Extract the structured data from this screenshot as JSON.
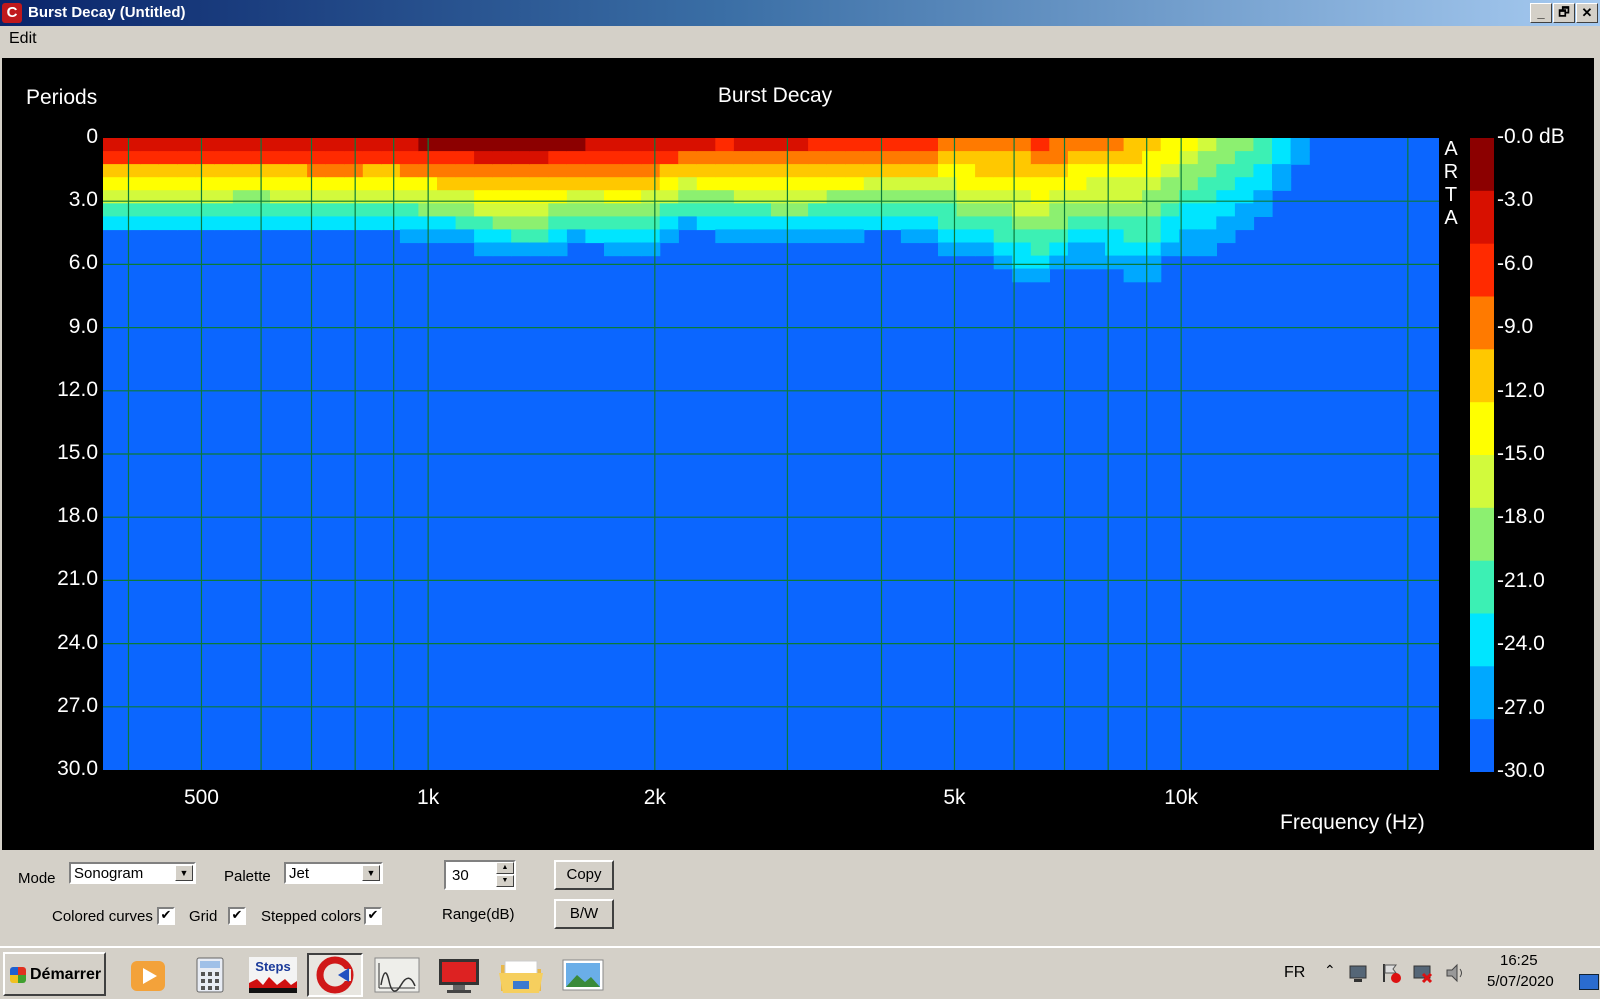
{
  "window": {
    "title": "Burst Decay  (Untitled)",
    "app_icon_letter": "C",
    "buttons": [
      "_",
      "🗗",
      "✕"
    ]
  },
  "menu": {
    "edit": "Edit"
  },
  "chart_data": {
    "type": "heatmap",
    "title": "Burst Decay",
    "xlabel": "Frequency (Hz)",
    "ylabel": "Periods",
    "x_scale": "log",
    "xlim": [
      370,
      22000
    ],
    "ylim": [
      0,
      30
    ],
    "x_ticks": [
      "500",
      "1k",
      "2k",
      "5k",
      "10k"
    ],
    "y_ticks": [
      "0",
      "3.0",
      "6.0",
      "9.0",
      "12.0",
      "15.0",
      "18.0",
      "21.0",
      "24.0",
      "27.0",
      "30.0"
    ],
    "colorbar_ticks": [
      "-0.0 dB",
      "-3.0",
      "-6.0",
      "-9.0",
      "-12.0",
      "-15.0",
      "-18.0",
      "-21.0",
      "-24.0",
      "-27.0",
      "-30.0"
    ],
    "colorbar_range_db": [
      -30,
      0
    ],
    "palette": [
      "#0b66ff",
      "#00a8ff",
      "#00e5ff",
      "#3cf0b4",
      "#8cf070",
      "#d2fa3c",
      "#ffff00",
      "#ffc800",
      "#ff7a00",
      "#ff2a00",
      "#d81000",
      "#8c0000"
    ],
    "grid": true,
    "brand": "ARTA",
    "decay_profile": {
      "freq_hz": [
        380,
        420,
        500,
        600,
        700,
        800,
        900,
        1000,
        1100,
        1200,
        1300,
        1400,
        1500,
        1600,
        1800,
        2000,
        2200,
        2500,
        3000,
        3500,
        4000,
        4500,
        5000,
        5500,
        6000,
        6500,
        7000,
        7500,
        8000,
        8500,
        9000,
        9500,
        10000,
        11000,
        12000,
        13000,
        14000,
        15000,
        20000
      ],
      "peak_level_db": [
        -1.5,
        -1.5,
        -1.5,
        -2.0,
        -1.0,
        -1.0,
        -1.5,
        -0.5,
        -0.5,
        -0.3,
        -0.2,
        -0.2,
        -0.5,
        -1.0,
        -1.5,
        -2.0,
        -3.0,
        -3.5,
        -3.0,
        -4.0,
        -4.5,
        -5.5,
        -6.5,
        -7.0,
        -7.5,
        -6.5,
        -7.0,
        -8.0,
        -8.5,
        -9.0,
        -10.0,
        -12.0,
        -13.5,
        -16.0,
        -18.0,
        -21.0,
        -24.0,
        -27.0,
        -30.0
      ],
      "decay_end_periods": [
        5.0,
        5.0,
        5.0,
        5.0,
        5.0,
        5.0,
        5.0,
        5.2,
        5.5,
        6.0,
        6.3,
        6.3,
        5.8,
        5.5,
        6.0,
        5.8,
        4.8,
        5.2,
        5.5,
        5.3,
        5.0,
        5.5,
        6.0,
        6.5,
        7.5,
        7.8,
        7.0,
        6.5,
        7.0,
        7.5,
        8.0,
        7.0,
        6.2,
        6.5,
        6.0,
        5.0,
        3.5,
        2.0,
        0.0
      ]
    }
  },
  "controls": {
    "mode_label": "Mode",
    "mode_value": "Sonogram",
    "palette_label": "Palette",
    "palette_value": "Jet",
    "range_value": "30",
    "range_label": "Range(dB)",
    "copy_button": "Copy",
    "bw_button": "B/W",
    "colored_curves_label": "Colored curves",
    "colored_curves_checked": true,
    "grid_label": "Grid",
    "grid_checked": true,
    "stepped_colors_label": "Stepped colors",
    "stepped_colors_checked": true,
    "check_glyph": "✔"
  },
  "taskbar": {
    "start_label": "Démarrer",
    "steps_label": "Steps",
    "language": "FR",
    "time": "16:25",
    "date": "5/07/2020"
  }
}
